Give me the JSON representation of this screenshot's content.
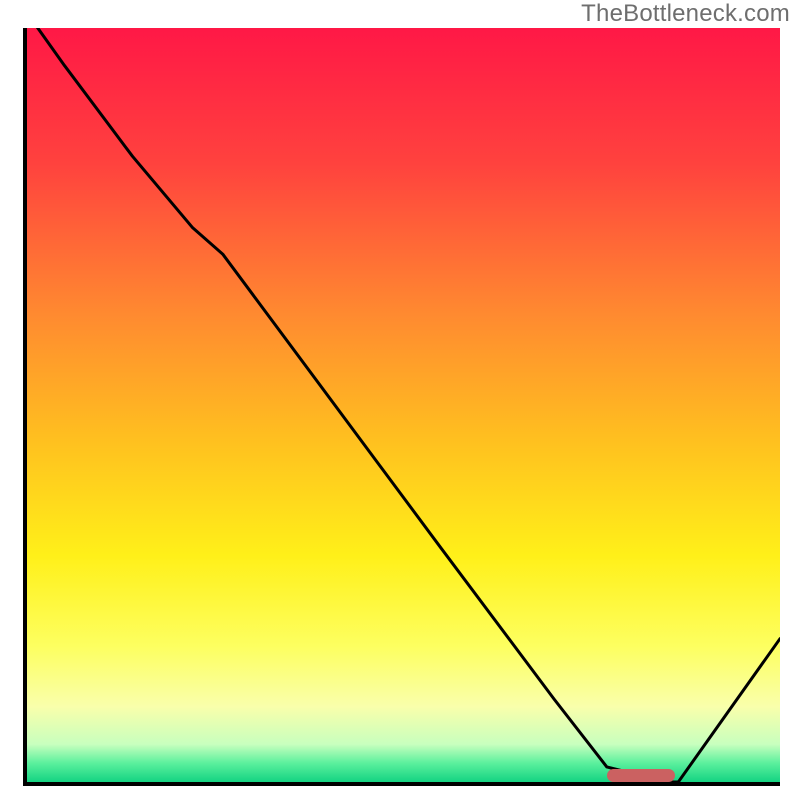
{
  "watermark": "TheBottleneck.com",
  "chart_data": {
    "type": "line",
    "title": "",
    "xlabel": "",
    "ylabel": "",
    "xlim": [
      0,
      100
    ],
    "ylim": [
      0,
      100
    ],
    "background_gradient": [
      {
        "pos": 0.0,
        "color": "#ff1846"
      },
      {
        "pos": 0.18,
        "color": "#ff423e"
      },
      {
        "pos": 0.38,
        "color": "#ff8a30"
      },
      {
        "pos": 0.55,
        "color": "#ffc11f"
      },
      {
        "pos": 0.7,
        "color": "#fff019"
      },
      {
        "pos": 0.82,
        "color": "#fdff60"
      },
      {
        "pos": 0.9,
        "color": "#f9ffab"
      },
      {
        "pos": 0.95,
        "color": "#c8ffbe"
      },
      {
        "pos": 0.975,
        "color": "#5bf09d"
      },
      {
        "pos": 1.0,
        "color": "#14d382"
      }
    ],
    "series": [
      {
        "name": "bottleneck-curve",
        "x": [
          0,
          5,
          14,
          22,
          26,
          55,
          70,
          77,
          85,
          86.5,
          100
        ],
        "y": [
          102,
          95,
          83,
          73.5,
          70,
          31,
          11,
          2,
          0,
          0,
          19
        ]
      }
    ],
    "marker": {
      "x_start": 77,
      "x_end": 86,
      "y": 0,
      "color": "#cb6161"
    }
  }
}
